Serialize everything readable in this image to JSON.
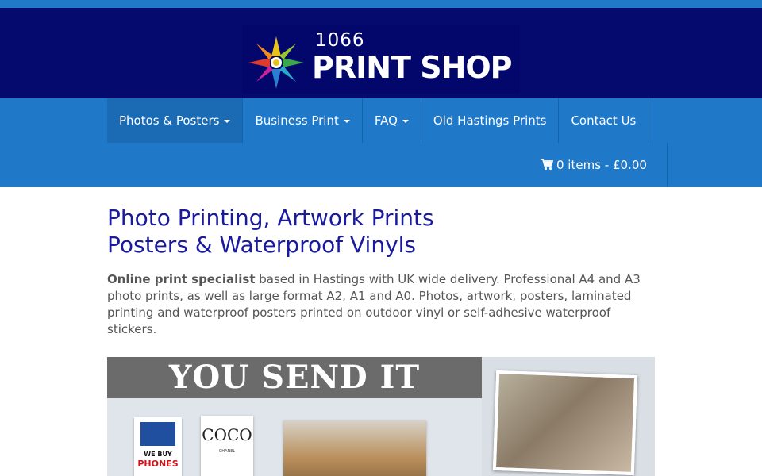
{
  "header": {
    "logo_number": "1066",
    "logo_name": "PRINT SHOP"
  },
  "nav": {
    "items": [
      {
        "label": "Photos & Posters",
        "dropdown": true,
        "active": true
      },
      {
        "label": "Business Print",
        "dropdown": true,
        "active": false
      },
      {
        "label": "FAQ",
        "dropdown": true,
        "active": false
      },
      {
        "label": "Old Hastings Prints",
        "dropdown": false,
        "active": false
      },
      {
        "label": "Contact Us",
        "dropdown": false,
        "active": false
      }
    ],
    "cart_label": "0 items - £0.00",
    "cart_icon": "shopping-cart-icon"
  },
  "main": {
    "title_line1": "Photo Printing, Artwork Prints",
    "title_line2": "Posters & Waterproof Vinyls",
    "intro_bold": "Online print specialist",
    "intro_text": " based in Hastings with UK wide delivery. Professional A4 and A3 photo prints, as well as large format A2, A1 and A0. Photos, artwork, posters, laminated printing and waterproof posters printed on outdoor vinyl or self-adhesive waterproof stickers."
  },
  "banner": {
    "headline": "YOU SEND IT",
    "poster1_line1": "WE BUY",
    "poster1_line2": "PHONES",
    "poster2_title": "COCO",
    "poster2_sub": "CHANEL"
  },
  "colors": {
    "top_strip": "#1f78c8",
    "header_bg": "#050a6e",
    "nav_bg": "#1f78c8",
    "title": "#1a1a9e"
  }
}
